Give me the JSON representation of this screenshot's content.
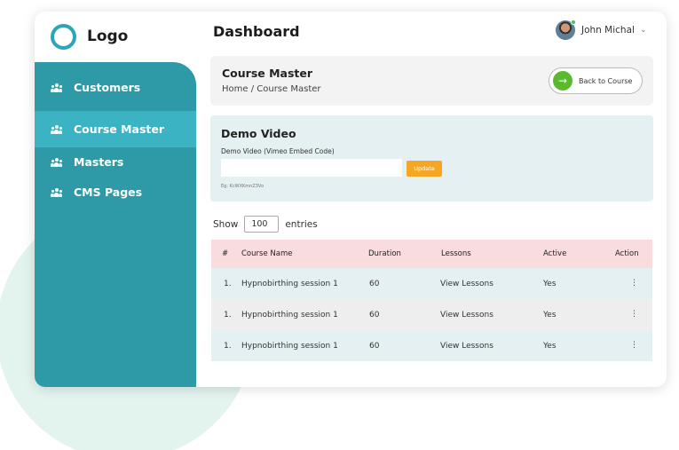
{
  "logo": {
    "text": "Logo"
  },
  "sidebar": {
    "items": [
      {
        "label": "Customers",
        "icon": "users-icon"
      },
      {
        "label": "Course Master",
        "icon": "users-icon",
        "active": true
      },
      {
        "label": "Masters",
        "icon": "users-icon"
      },
      {
        "label": "CMS Pages",
        "icon": "users-icon"
      }
    ]
  },
  "header": {
    "title": "Dashboard",
    "user_name": "John Michal",
    "caret": "⌄"
  },
  "course": {
    "title": "Course Master",
    "breadcrumb": "Home / Course Master",
    "back_label": "Back to Course",
    "back_icon": "→"
  },
  "demo": {
    "title": "Demo Video",
    "field_label": "Demo Video (Vimeo Embed Code)",
    "field_value": "",
    "update_label": "Update",
    "hint": "Eg: KcWXKmnZ3Vo"
  },
  "entries": {
    "show_label": "Show",
    "value": "100",
    "entries_label": "entries"
  },
  "table": {
    "columns": [
      "#",
      "Course Name",
      "Duration",
      "Lessons",
      "Active",
      "Action"
    ],
    "rows": [
      {
        "num": "1.",
        "name": "Hypnobirthing session 1",
        "duration": "60",
        "lessons": "View Lessons",
        "active": "Yes",
        "action": "⋮"
      },
      {
        "num": "1.",
        "name": "Hypnobirthing session 1",
        "duration": "60",
        "lessons": "View Lessons",
        "active": "Yes",
        "action": "⋮"
      },
      {
        "num": "1.",
        "name": "Hypnobirthing session 1",
        "duration": "60",
        "lessons": "View Lessons",
        "active": "Yes",
        "action": "⋮"
      }
    ]
  },
  "colors": {
    "sidebar": "#2e9aa8",
    "sidebar_active": "#3bb3c3",
    "accent_green": "#5aba2e",
    "update_orange": "#f5a623",
    "table_head": "#f9dcde"
  }
}
